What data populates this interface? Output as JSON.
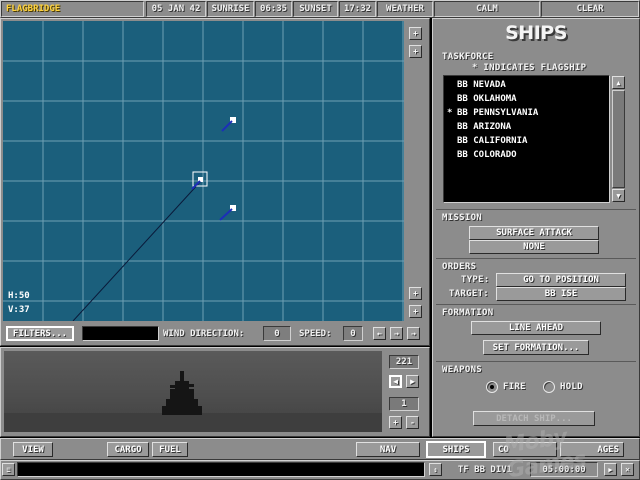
{
  "topbar": {
    "title": "FLAGBRIDGE",
    "date": "05 JAN 42",
    "sunrise_label": "SUNRISE",
    "sunrise_time": "06:35",
    "sunset_label": "SUNSET",
    "sunset_time": "17:32",
    "weather_label": "WEATHER",
    "weather_value": "CALM",
    "clear_label": "CLEAR"
  },
  "map": {
    "h_readout": "H:50",
    "v_readout": "V:37",
    "filters_label": "FILTERS...",
    "wind_label": "WIND DIRECTION:",
    "wind_value": "0",
    "speed_label": "SPEED:",
    "speed_value": "0",
    "scroll_up": "+",
    "scroll_down": "+",
    "zoom_out": "+",
    "zoom_in": "+",
    "arrow_left": "←",
    "arrow_right": "→",
    "arrow_far_right": "→"
  },
  "view_panel": {
    "heading_value": "221",
    "zoom_value": "1",
    "rotate_left": "◀",
    "rotate_right": "▶",
    "zoom_plus": "+",
    "zoom_minus": "-"
  },
  "ships_panel": {
    "title": "SHIPS",
    "taskforce_label": "TASKFORCE",
    "flagship_note": "* INDICATES FLAGSHIP",
    "ships": [
      {
        "flag": "",
        "name": "BB NEVADA"
      },
      {
        "flag": "",
        "name": "BB OKLAHOMA"
      },
      {
        "flag": "*",
        "name": "BB PENNSYLVANIA"
      },
      {
        "flag": "",
        "name": "BB ARIZONA"
      },
      {
        "flag": "",
        "name": "BB CALIFORNIA"
      },
      {
        "flag": "",
        "name": "BB COLORADO"
      }
    ],
    "mission_label": "MISSION",
    "mission_primary": "SURFACE ATTACK",
    "mission_secondary": "NONE",
    "orders_label": "ORDERS",
    "type_label": "TYPE:",
    "type_value": "GO TO POSITION",
    "target_label": "TARGET:",
    "target_value": "BB ISE",
    "formation_label": "FORMATION",
    "formation_value": "LINE AHEAD",
    "set_formation_label": "SET FORMATION...",
    "weapons_label": "WEAPONS",
    "fire_label": "FIRE",
    "hold_label": "HOLD",
    "detach_label": "DETACH SHIP...",
    "weapons_selected": "fire"
  },
  "bottom_bar": {
    "view_label": "VIEW",
    "cargo_label": "CARGO",
    "fuel_label": "FUEL",
    "nav_label": "NAV",
    "ships_label": "SHIPS",
    "combat_label": "CO",
    "damage_label": "AGES",
    "group_label": "TF BB DIV1",
    "clock": "05:00:00",
    "watermark": "Moby Games"
  },
  "colors": {
    "map_water": "#1b5f7c",
    "grid_line": "#6fa0b4",
    "chrome": "#8c8c8c",
    "list_bg": "#000000"
  },
  "icons": [
    "scroll-up-icon",
    "scroll-down-icon",
    "zoom-icon",
    "ship-marker-icon",
    "flagship-marker-icon",
    "radio-icon"
  ]
}
